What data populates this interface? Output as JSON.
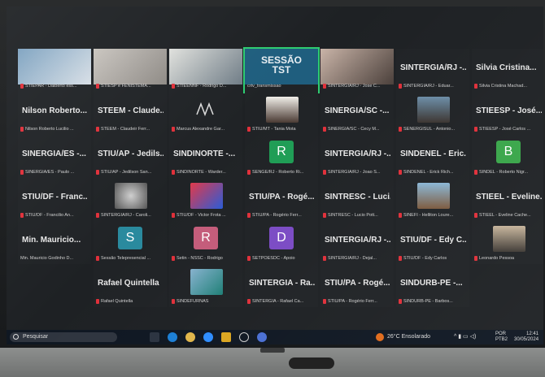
{
  "row1": [
    {
      "name": "",
      "cap": "STIEPAR - Dalberto ess..."
    },
    {
      "name": "",
      "cap": "STIESP e FENISTEMA..."
    },
    {
      "name": "",
      "cap": "STIEENNF - Rodrigo D..."
    },
    {
      "name": "SESSÃO TST",
      "cap": "crtv_transmissao"
    },
    {
      "name": "",
      "cap": "SINTERGIA/RJ - Jose C..."
    },
    {
      "name": "SINTERGIA/RJ -...",
      "cap": "SINTERGIA/RJ - Eduar..."
    },
    {
      "name": "Silvia Cristina...",
      "cap": "Silvia Cristina Machad..."
    }
  ],
  "row2": [
    {
      "name": "Nilson Roberto...",
      "cap": "Nilson Roberto Lucilio ..."
    },
    {
      "name": "STEEM - Claude...",
      "cap": "STEEM - Claudeir Ferr..."
    },
    {
      "name": "",
      "cap": "Marcus Alexandre Gar..."
    },
    {
      "name": "",
      "cap": "STIU/MT - Tania Mota"
    },
    {
      "name": "SINERGIA/SC -...",
      "cap": "SINERGIA/SC - Cecy M..."
    },
    {
      "name": "",
      "cap": "SENERGISUL - Antonio..."
    },
    {
      "name": "STIEESP - José...",
      "cap": "STIEESP - José Carlos ..."
    }
  ],
  "row3": [
    {
      "name": "SINERGIA/ES -...",
      "cap": "SINERGIA/ES - Paulo ..."
    },
    {
      "name": "STIU/AP - Jedils...",
      "cap": "STIU/AP - Jedilson San..."
    },
    {
      "name": "SINDINORTE -...",
      "cap": "SINDINORTE - Warder..."
    },
    {
      "name": "R",
      "cap": "SENGE/RJ - Roberto Ri..."
    },
    {
      "name": "SINTERGIA/RJ -...",
      "cap": "SINTERGIA/RJ - Joao S..."
    },
    {
      "name": "SINDENEL - Eric...",
      "cap": "SINDENEL - Erick Rich..."
    },
    {
      "name": "B",
      "cap": "SINDEL - Roberto Nigr..."
    }
  ],
  "row4": [
    {
      "name": "STIU/DF - Franc...",
      "cap": "STIU/DF - Francilio An..."
    },
    {
      "name": "",
      "cap": "SINTERGIA/RJ - Caroli..."
    },
    {
      "name": "",
      "cap": "STIU/DF - Victor Frota ..."
    },
    {
      "name": "STIU/PA - Rogé...",
      "cap": "STIU/PA - Rogério Ferr..."
    },
    {
      "name": "SINTRESC - Luci...",
      "cap": "SINTRESC - Lucio Pott..."
    },
    {
      "name": "",
      "cap": "SINEFI - Helliton Loure..."
    },
    {
      "name": "STIEEL - Eveline...",
      "cap": "STIEEL - Eveline Cache..."
    }
  ],
  "row5": [
    {
      "name": "Min. Mauricio...",
      "cap": "Min. Mauricio Godinho D..."
    },
    {
      "name": "S",
      "cap": "Sessão Telepresencial ..."
    },
    {
      "name": "R",
      "cap": "Setin - NSSC - Rodrigo"
    },
    {
      "name": "D",
      "cap": "SETPOESDC - Apoio"
    },
    {
      "name": "SINTERGIA/RJ -...",
      "cap": "SINTERGIA/RJ - Dejal..."
    },
    {
      "name": "STIU/DF - Edy C...",
      "cap": "STIU/DF - Edy Carlos"
    },
    {
      "name": "",
      "cap": "Leonardo Pessoa"
    }
  ],
  "row6": [
    {
      "name": "Rafael Quintella",
      "cap": "Rafael Quintella"
    },
    {
      "name": "",
      "cap": "SINDEFURNAS"
    },
    {
      "name": "SINTERGIA - Ra...",
      "cap": "SINTERGIA - Rafael Ca..."
    },
    {
      "name": "STIU/PA - Rogé...",
      "cap": "STIU/PA - Rogério Ferr..."
    },
    {
      "name": "SINDURB-PE -...",
      "cap": "SINDURB-PE - Barbos..."
    }
  ],
  "taskbar": {
    "search_placeholder": "Pesquisar",
    "weather": "26°C Ensolarado",
    "lang1": "POR",
    "lang2": "PTB2",
    "time": "12:41",
    "date": "30/05/2024"
  },
  "colors": {
    "green": "#1f9d55",
    "teal": "#2a8a9e",
    "pink": "#c45c7a",
    "purple": "#7b4bc4",
    "mic": "#e0303a"
  }
}
